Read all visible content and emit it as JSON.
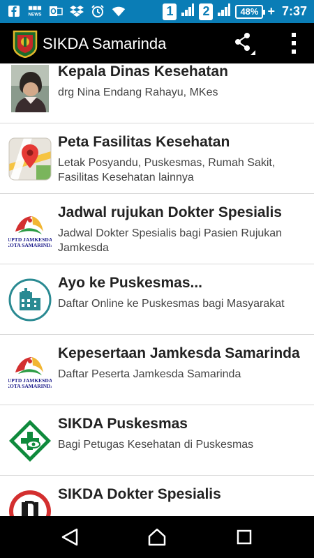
{
  "status_bar": {
    "left_icons": [
      "fb-icon",
      "bbc-news-icon",
      "outlook-icon",
      "dropbox-icon",
      "alarm-icon",
      "wifi-icon"
    ],
    "sim1": "1",
    "sim2": "2",
    "battery": "48%",
    "time": "7:37"
  },
  "app_bar": {
    "title": "SIKDA Samarinda"
  },
  "list": {
    "items": [
      {
        "title": "Kepala Dinas Kesehatan",
        "subtitle": "drg Nina Endang Rahayu, MKes",
        "icon": "portrait-photo"
      },
      {
        "title": "Peta Fasilitas Kesehatan",
        "subtitle": "Letak Posyandu, Puskesmas, Rumah Sakit, Fasilitas Kesehatan lainnya",
        "icon": "maps-icon"
      },
      {
        "title": "Jadwal rujukan Dokter Spesialis",
        "subtitle": "Jadwal Dokter Spesialis bagi Pasien Rujukan Jamkesda",
        "icon": "uptd-jamkesda-logo"
      },
      {
        "title": "Ayo ke Puskesmas...",
        "subtitle": "Daftar Online ke Puskesmas bagi Masyarakat",
        "icon": "hospital-building-icon"
      },
      {
        "title": "Kepesertaan Jamkesda Samarinda",
        "subtitle": "Daftar Peserta Jamkesda Samarinda",
        "icon": "uptd-jamkesda-logo"
      },
      {
        "title": "SIKDA Puskesmas",
        "subtitle": "Bagi Petugas Kesehatan di Puskesmas",
        "icon": "puskesmas-logo"
      },
      {
        "title": "SIKDA Dokter Spesialis",
        "subtitle": "",
        "icon": "idi-logo"
      }
    ],
    "logo_text_line1": "UPTD JAMKESDA",
    "logo_text_line2": "KOTA SAMARINDA"
  },
  "colors": {
    "status_bar": "#0a7db6",
    "app_bar": "#000000",
    "divider": "#d8d8d8",
    "teal": "#2a8a92",
    "green": "#0f8a3c"
  }
}
